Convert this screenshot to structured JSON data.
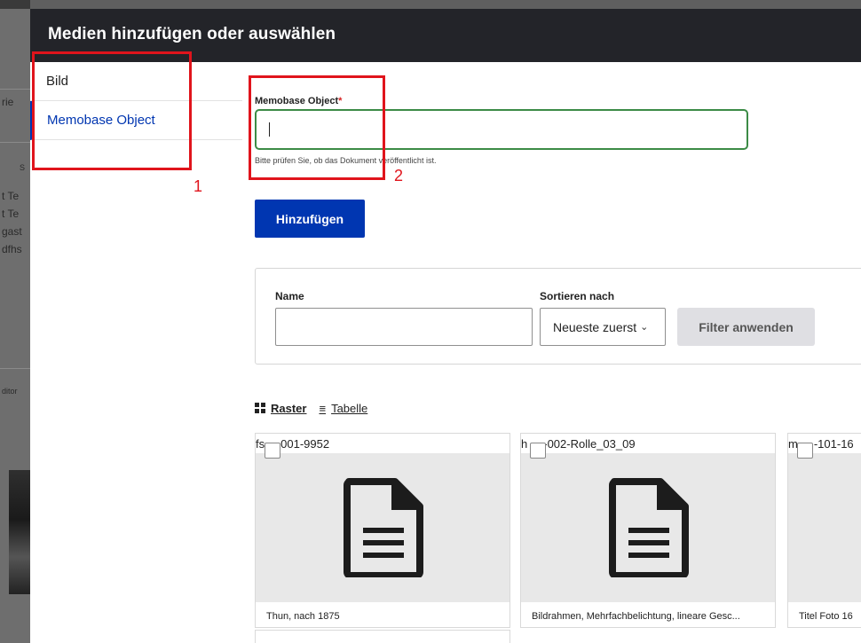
{
  "modal": {
    "title": "Medien hinzufügen oder auswählen"
  },
  "tabs": [
    {
      "label": "Bild",
      "active": false
    },
    {
      "label": "Memobase Object",
      "active": true
    }
  ],
  "form": {
    "label": "Memobase Object",
    "required_marker": "*",
    "value": "",
    "help": "Bitte prüfen Sie, ob das Dokument veröffentlicht ist.",
    "add_button": "Hinzufügen"
  },
  "filter": {
    "name_label": "Name",
    "name_value": "",
    "sort_label": "Sortieren nach",
    "sort_value": "Neueste zuerst",
    "apply_label": "Filter anwenden"
  },
  "view": {
    "raster_label": "Raster",
    "table_label": "Tabelle",
    "active": "Raster"
  },
  "cards": [
    {
      "title_start": "fs",
      "title_end": "001-9952",
      "caption": "Thun, nach 1875",
      "icon": "document-icon"
    },
    {
      "title_start": "h",
      "title_end": "-002-Rolle_03_09",
      "caption": "Bildrahmen, Mehrfachbelichtung, lineare Gesc...",
      "icon": "document-icon"
    },
    {
      "title_start": "m",
      "title_end": "-101-16",
      "caption": "Titel Foto 16",
      "icon": "document-icon"
    }
  ],
  "annotations": [
    {
      "label": "1",
      "color": "#e0141c"
    },
    {
      "label": "2",
      "color": "#e0141c"
    }
  ],
  "background_page": {
    "fragments": [
      "rie",
      "S",
      "t Te",
      "t Te",
      "gast",
      "dfhs",
      "ditor"
    ]
  },
  "colors": {
    "header_bg": "#232429",
    "accent": "#0036b1",
    "input_focus": "#3c8b46",
    "annotation": "#e0141c"
  }
}
